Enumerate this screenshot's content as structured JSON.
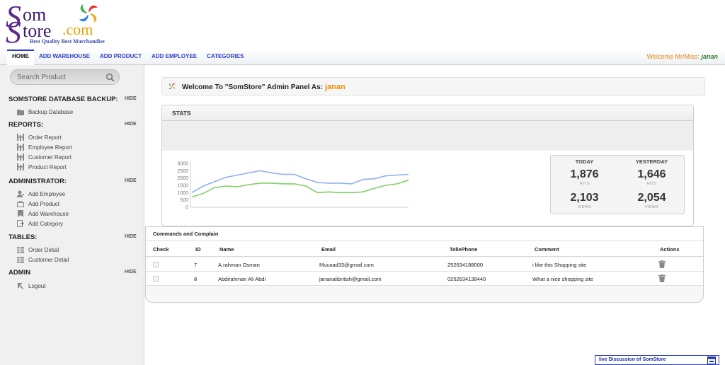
{
  "brand": {
    "line1": "om",
    "line2": "tore",
    "suffix": ".com",
    "tagline": "Best Quality Best Marchandise",
    "primary_color": "#5a2a8e",
    "accent_color": "#e8a000"
  },
  "nav": {
    "items": [
      "HOME",
      "ADD WAREHOUSE",
      "ADD PRODUCT",
      "ADD EMPLOYEE",
      "CATEGORIES"
    ],
    "active": "HOME",
    "welcome_label": "Welcome Mr/Miss:",
    "welcome_user": "janan"
  },
  "sidebar": {
    "search_placeholder": "Search Product",
    "hide_label": "HIDE",
    "sections": [
      {
        "title": "SOMSTORE DATABASE BACKUP:",
        "items": [
          {
            "label": "Backup Database",
            "icon": "folder-icon"
          }
        ]
      },
      {
        "title": "REPORTS:",
        "items": [
          {
            "label": "Order Report",
            "icon": "report-icon"
          },
          {
            "label": "Employee Report",
            "icon": "report-icon"
          },
          {
            "label": "Customer Report",
            "icon": "report-icon"
          },
          {
            "label": "Product Report",
            "icon": "report-icon"
          }
        ]
      },
      {
        "title": "ADMINISTRATOR:",
        "items": [
          {
            "label": "Add Employee",
            "icon": "user-add-icon"
          },
          {
            "label": "Add Product",
            "icon": "box-icon"
          },
          {
            "label": "Add Warehouse",
            "icon": "bookmark-icon"
          },
          {
            "label": "Add Category",
            "icon": "category-icon"
          }
        ]
      },
      {
        "title": "TABLES:",
        "items": [
          {
            "label": "Order Detial",
            "icon": "table-icon"
          },
          {
            "label": "Customer Detail",
            "icon": "table-icon"
          }
        ]
      },
      {
        "title": "ADMIN",
        "items": [
          {
            "label": "Logout",
            "icon": "logout-icon"
          }
        ]
      }
    ]
  },
  "main": {
    "welcome_text": "Welcome To \"SomStore\" Admin Panel As:",
    "welcome_user": "janan",
    "stats": {
      "title": "STATS",
      "today_label": "TODAY",
      "yesterday_label": "YESTERDAY",
      "today_hits": "1,876",
      "today_views": "2,103",
      "yesterday_hits": "1,646",
      "yesterday_views": "2,054",
      "hits_label": "HITS",
      "views_label": "VIEWS"
    },
    "commands": {
      "title": "Commands and Complain",
      "columns": [
        "Check",
        "ID",
        "Name",
        "Email",
        "TellePhone",
        "Comment",
        "Actions"
      ],
      "rows": [
        {
          "id": "7",
          "name": "A.rahman Osman",
          "email": "Mucaad33@gmail.com",
          "phone": "252634188000",
          "comment": "i like this Shopping site"
        },
        {
          "id": "8",
          "name": "Abdirahman Ali Abdi",
          "email": "jananalibritish@gmail.com",
          "phone": "0252634138440",
          "comment": "What a nice shopping site"
        }
      ]
    }
  },
  "live": {
    "label": "live Discussion of SomStore"
  },
  "chart_data": {
    "type": "line",
    "x": [
      0,
      1,
      2,
      3,
      4,
      5,
      6,
      7,
      8,
      9,
      10,
      11,
      12,
      13,
      14,
      15,
      16,
      17
    ],
    "series": [
      {
        "values": [
          1000,
          1450,
          1750,
          2050,
          2200,
          2350,
          2500,
          2350,
          2250,
          2250,
          1950,
          1700,
          1650,
          1650,
          1600,
          1900,
          1950,
          2150,
          2200,
          2250
        ],
        "color": "#8fb0f0"
      },
      {
        "values": [
          700,
          950,
          1350,
          1450,
          1400,
          1550,
          1650,
          1650,
          1600,
          1600,
          1450,
          1000,
          1050,
          1000,
          1000,
          1050,
          1300,
          1500,
          1600,
          1850
        ],
        "color": "#7fcf62"
      }
    ],
    "y_ticks": [
      "3000",
      "2500",
      "2000",
      "1500",
      "1000",
      "500",
      "0"
    ],
    "ylim": [
      0,
      3000
    ],
    "grid": false
  }
}
